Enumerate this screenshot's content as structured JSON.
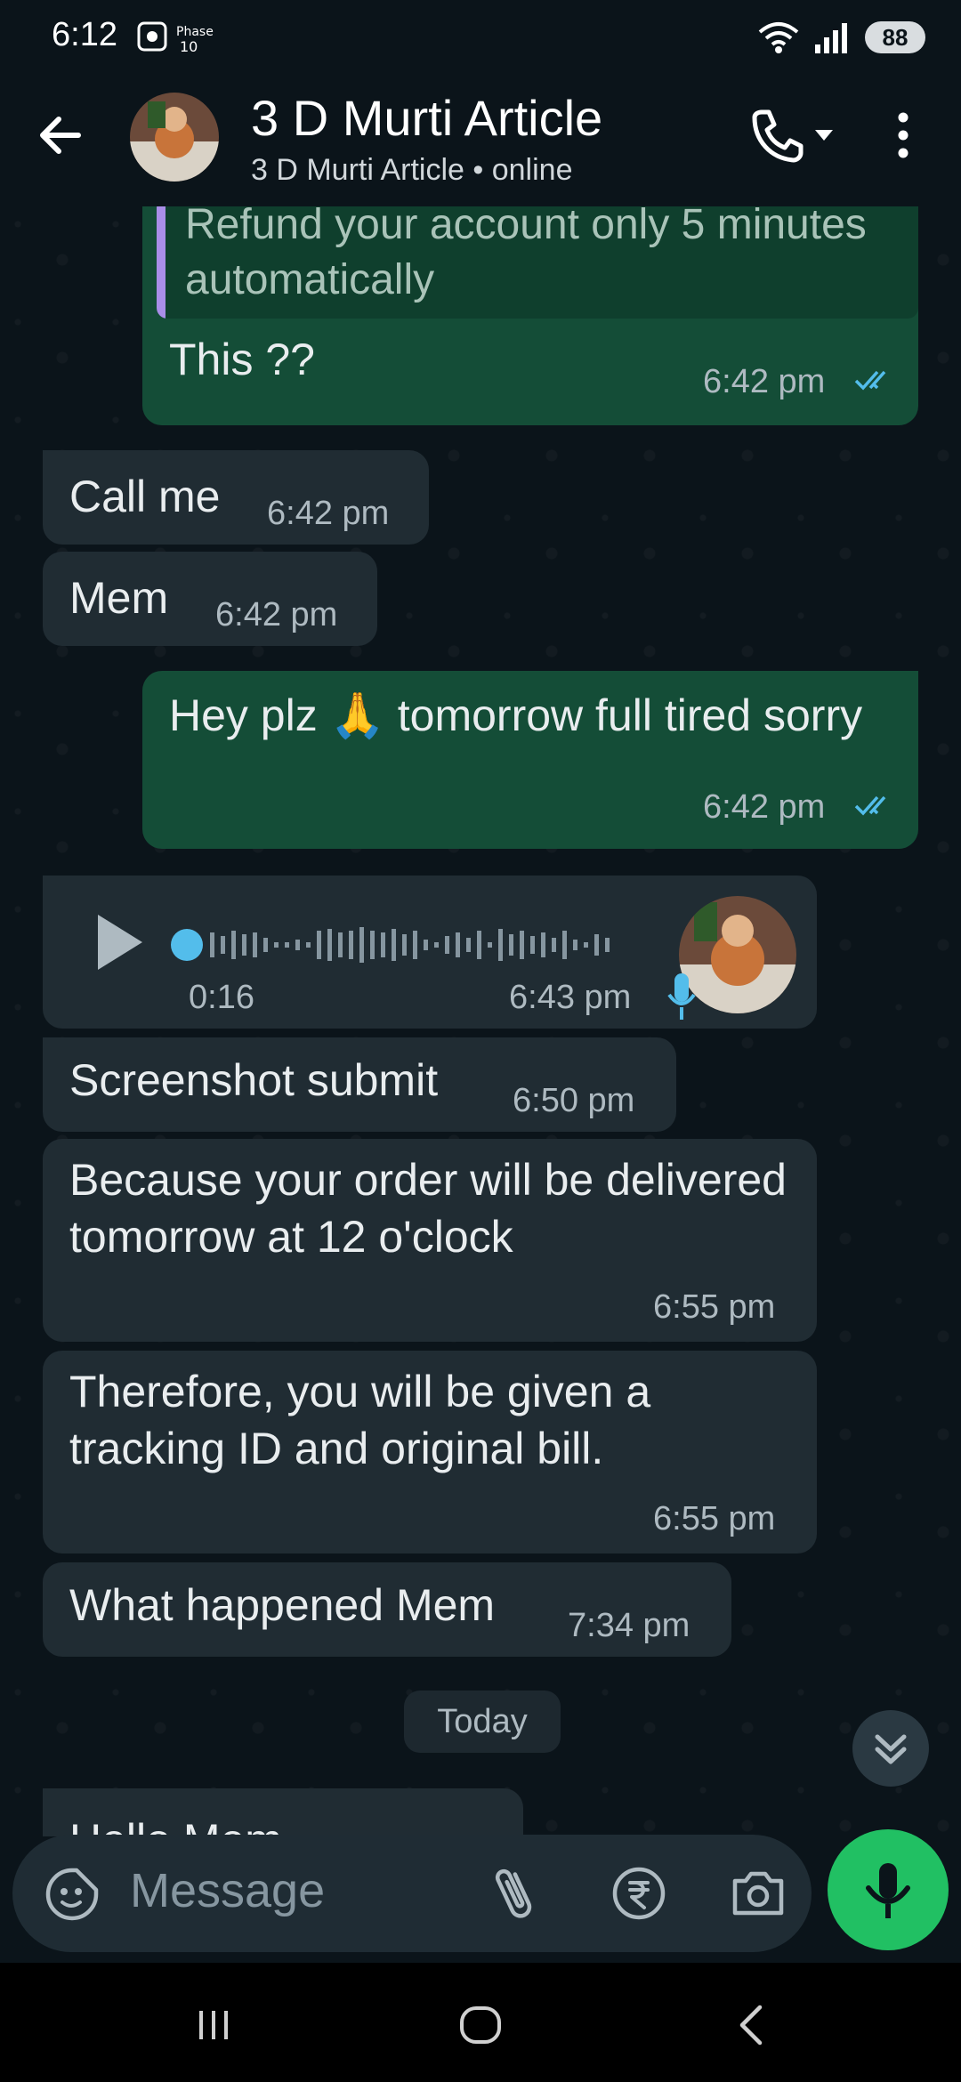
{
  "status_bar": {
    "time": "6:12",
    "left_badge": "Phase 10",
    "battery": "88"
  },
  "header": {
    "title": "3 D Murti Article",
    "subtitle": "3 D Murti Article • online"
  },
  "messages": [
    {
      "direction": "outgoing",
      "quoted_text": "Refund your account only 5 minutes automatically",
      "text": "This ??",
      "time": "6:42 pm",
      "status": "read"
    },
    {
      "direction": "incoming",
      "text": "Call me",
      "time": "6:42 pm"
    },
    {
      "direction": "incoming",
      "text": "Mem",
      "time": "6:42 pm"
    },
    {
      "direction": "outgoing",
      "text": "Hey plz 🙏 tomorrow full tired sorry",
      "time": "6:42 pm",
      "status": "read"
    },
    {
      "direction": "incoming",
      "type": "voice",
      "duration": "0:16",
      "time": "6:43 pm"
    },
    {
      "direction": "incoming",
      "text": "Screenshot submit",
      "time": "6:50 pm"
    },
    {
      "direction": "incoming",
      "text": "Because your order will be delivered tomorrow at 12 o'clock",
      "time": "6:55 pm"
    },
    {
      "direction": "incoming",
      "text": "Therefore, you will be given a tracking ID and original bill.",
      "time": "6:55 pm"
    },
    {
      "direction": "incoming",
      "text": "What happened Mem",
      "time": "7:34 pm"
    },
    {
      "direction": "incoming",
      "text": "Hello Mem",
      "partial": true
    }
  ],
  "date_divider": "Today",
  "input": {
    "placeholder": "Message"
  },
  "colors": {
    "background": "#0b141a",
    "outgoing_bubble": "#144d37",
    "incoming_bubble": "#202c33",
    "accent_green": "#21c063",
    "read_ticks": "#53bdeb"
  },
  "icons": {
    "back": "arrow-left-icon",
    "call": "phone-icon",
    "more": "more-vertical-icon",
    "emoji": "sticker-icon",
    "attach": "paperclip-icon",
    "payment": "rupee-icon",
    "camera": "camera-icon",
    "mic": "mic-icon"
  }
}
